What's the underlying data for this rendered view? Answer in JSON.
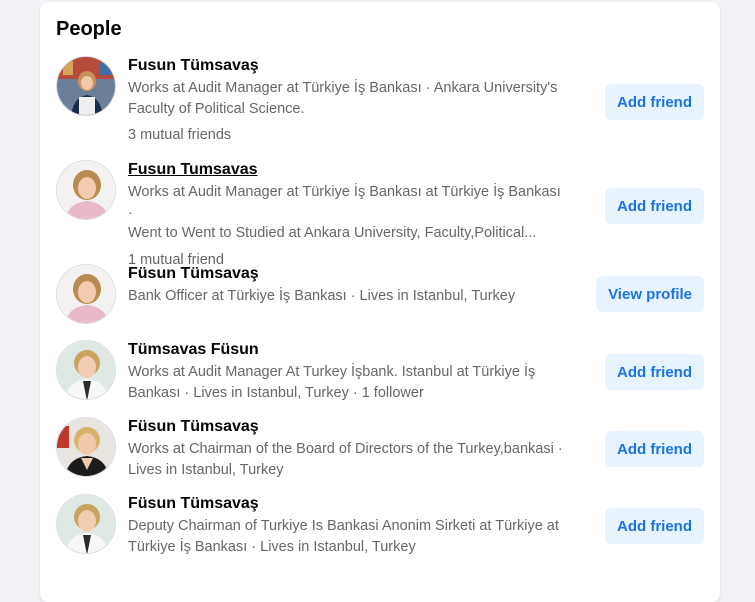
{
  "section_title": "People",
  "results": [
    {
      "name": "Fusun Tümsavaş",
      "desc": "Works at Audit Manager at Türkiye İş Bankası · Ankara University's\nFaculty of Political Science.",
      "mutual": "3 mutual friends",
      "action": "Add friend"
    },
    {
      "name": "Fusun Tumsavas",
      "desc": "Works at Audit Manager at Türkiye İş Bankası at Türkiye İş Bankası ·\nWent to Went to Studied at Ankara University, Faculty,Political...",
      "mutual": "1 mutual friend",
      "action": "Add friend"
    },
    {
      "name": "Füsun Tümsavaş",
      "desc": "Bank Officer at Türkiye İş Bankası · Lives in Istanbul, Turkey",
      "action": "View profile"
    },
    {
      "name": "Tümsavas Füsun",
      "desc": "Works at Audit Manager At Turkey İşbank. Istanbul at Türkiye İş\nBankası · Lives in Istanbul, Turkey · 1 follower",
      "action": "Add friend"
    },
    {
      "name": "Füsun Tümsavaş",
      "desc": "Works at Chairman of the Board of Directors of the Turkey,bankasi ·\nLives in Istanbul, Turkey",
      "action": "Add friend"
    },
    {
      "name": "Füsun Tümsavaş",
      "desc": "Deputy Chairman of Turkiye Is Bankasi Anonim Sirketi at Türkiye at\nTürkiye İş Bankası · Lives in Istanbul, Turkey",
      "action": "Add friend"
    }
  ]
}
